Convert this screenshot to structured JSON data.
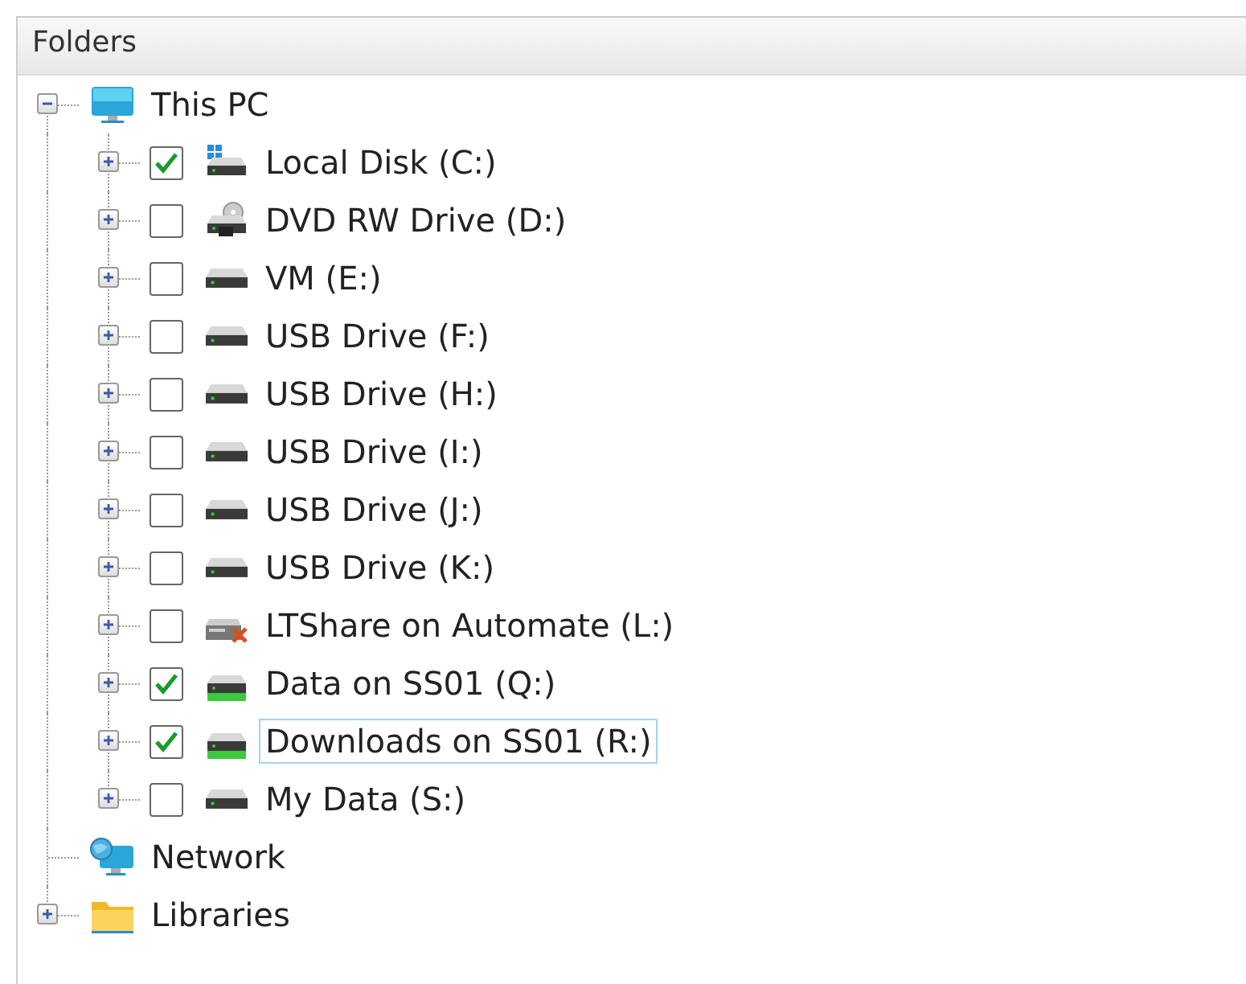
{
  "panel": {
    "title": "Folders"
  },
  "tree": [
    {
      "label": "This PC",
      "kind": "computer",
      "expanded": true,
      "selected": false,
      "children": [
        {
          "label": "Local Disk (C:)",
          "kind": "system-disk",
          "expanded": false,
          "checked": true,
          "selected": false
        },
        {
          "label": "DVD RW Drive (D:)",
          "kind": "dvd",
          "expanded": false,
          "checked": false,
          "selected": false
        },
        {
          "label": "VM (E:)",
          "kind": "drive",
          "expanded": false,
          "checked": false,
          "selected": false
        },
        {
          "label": "USB Drive (F:)",
          "kind": "drive",
          "expanded": false,
          "checked": false,
          "selected": false
        },
        {
          "label": "USB Drive (H:)",
          "kind": "drive",
          "expanded": false,
          "checked": false,
          "selected": false
        },
        {
          "label": "USB Drive (I:)",
          "kind": "drive",
          "expanded": false,
          "checked": false,
          "selected": false
        },
        {
          "label": "USB Drive (J:)",
          "kind": "drive",
          "expanded": false,
          "checked": false,
          "selected": false
        },
        {
          "label": "USB Drive (K:)",
          "kind": "drive",
          "expanded": false,
          "checked": false,
          "selected": false
        },
        {
          "label": "LTShare on Automate (L:)",
          "kind": "offline-share",
          "expanded": false,
          "checked": false,
          "selected": false
        },
        {
          "label": "Data on SS01 (Q:)",
          "kind": "share",
          "expanded": false,
          "checked": true,
          "selected": false
        },
        {
          "label": "Downloads on SS01 (R:)",
          "kind": "share",
          "expanded": false,
          "checked": true,
          "selected": true
        },
        {
          "label": "My Data (S:)",
          "kind": "drive",
          "expanded": false,
          "checked": false,
          "selected": false
        }
      ]
    },
    {
      "label": "Network",
      "kind": "network",
      "selected": false
    },
    {
      "label": "Libraries",
      "kind": "library",
      "expanded": false,
      "selected": false
    }
  ]
}
